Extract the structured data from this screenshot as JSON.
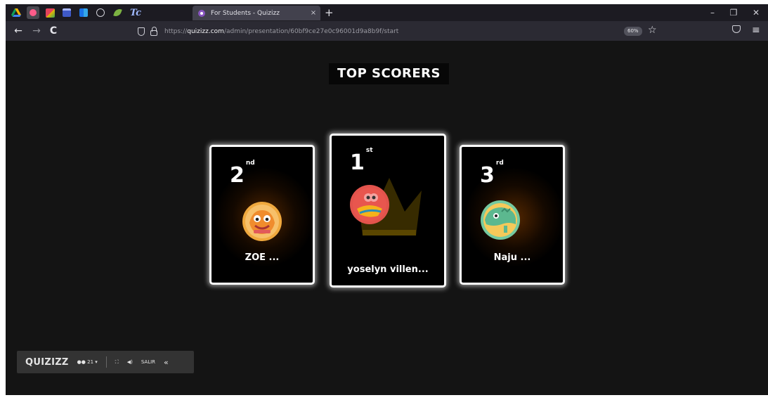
{
  "browser": {
    "pinned_tabs": [
      {
        "name": "google-drive-icon",
        "color": "#f4b400"
      },
      {
        "name": "quizizz-pinned-icon",
        "color": "#8854c0"
      },
      {
        "name": "colorful-app-icon",
        "color": "#e3435b"
      },
      {
        "name": "calendar-icon",
        "color": "#3f5ac8"
      },
      {
        "name": "grid-app-icon",
        "color": "#1a73e8"
      },
      {
        "name": "globe-icon",
        "color": "#cfcfd6"
      },
      {
        "name": "leaf-icon",
        "color": "#7cb342"
      },
      {
        "name": "tc-icon",
        "color": "#9fb8ff"
      }
    ],
    "active_tab": {
      "title": "For Students - Quizizz",
      "close": "×"
    },
    "new_tab": "+",
    "window_controls": {
      "minimize": "–",
      "restore": "❐",
      "close": "✕"
    },
    "nav": {
      "back": "←",
      "forward": "→",
      "reload": "C"
    },
    "url": {
      "scheme": "https://",
      "domain": "quizizz.com",
      "path": "/admin/presentation/60bf9ce27e0c96001d9a8b9f/start"
    },
    "zoom": "60%",
    "bookmark_star": "☆",
    "menu_icon": "≡"
  },
  "page": {
    "title": "TOP SCORERS",
    "accent_gold": "#f2b200",
    "cards": [
      {
        "rank": "2",
        "suffix": "nd",
        "name": "ZOE ...",
        "avatar": "orange-monster-avatar-icon",
        "avatar_bg": "#f0a93e"
      },
      {
        "rank": "1",
        "suffix": "st",
        "name": "yoselyn villen...",
        "avatar": "red-monster-avatar-icon",
        "avatar_bg": "#e2534c"
      },
      {
        "rank": "3",
        "suffix": "rd",
        "name": "Naju ...",
        "avatar": "green-monster-avatar-icon",
        "avatar_bg": "#74c9a0"
      }
    ]
  },
  "toolbar": {
    "logo": "QUIZIZZ",
    "players_count": "21",
    "players_caret": "▾",
    "fullscreen_icon": "⛶",
    "volume_icon": "◀)",
    "exit_label": "SALIR",
    "collapse_icon": "«"
  }
}
